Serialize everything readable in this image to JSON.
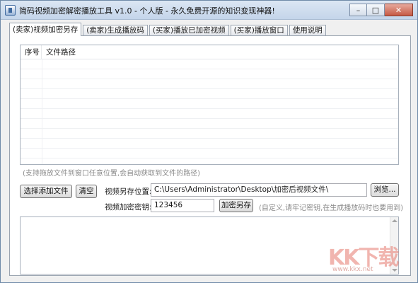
{
  "window": {
    "title": "简码视频加密解密播放工具 v1.0 - 个人版 - 永久免费开源的知识变现神器!",
    "controls": {
      "minimize": "–",
      "maximize": "□",
      "close": "✕"
    }
  },
  "tabs": [
    {
      "label": "(卖家)视频加密另存",
      "active": true
    },
    {
      "label": "(卖家)生成播放码"
    },
    {
      "label": "(买家)播放已加密视频"
    },
    {
      "label": "(买家)播放窗口"
    },
    {
      "label": "使用说明"
    }
  ],
  "file_list": {
    "columns": {
      "no": "序号",
      "path": "文件路径"
    },
    "rows": []
  },
  "drag_hint": "(支持拖放文件到窗口任意位置,会自动获取到文件的路径)",
  "buttons": {
    "select_add": "选择添加文件",
    "clear": "清空",
    "browse": "浏览...",
    "encrypt_save": "加密另存"
  },
  "save_location": {
    "label": "视频另存位置:",
    "value": "C:\\Users\\Administrator\\Desktop\\加密后视频文件\\"
  },
  "encrypt_key": {
    "label": "视频加密密钥:",
    "value": "123456",
    "note": "(自定义,请牢记密钥,在生成播放码时也要用到)"
  },
  "watermark": {
    "mark": "KK下载",
    "url": "www.kkx.net"
  }
}
